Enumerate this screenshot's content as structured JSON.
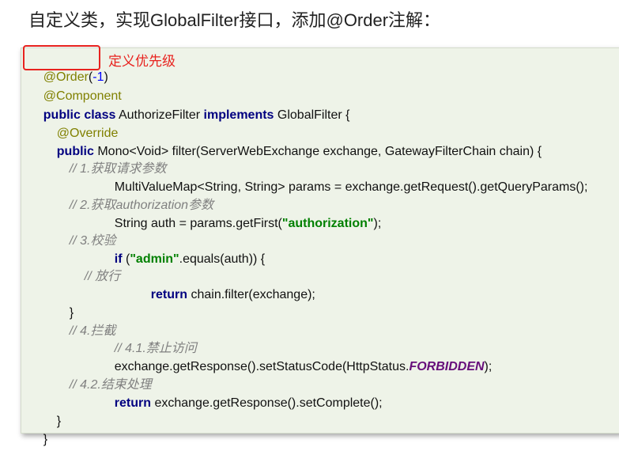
{
  "heading": "自定义类，实现GlobalFilter接口，添加@Order注解：",
  "callout": "定义优先级",
  "code": {
    "l1": {
      "ann": "@Order",
      "p1": "(",
      "num": "-1",
      "p2": ")"
    },
    "l2": {
      "ann": "@Component"
    },
    "l3": {
      "kw1": "public class",
      "t1": " AuthorizeFilter ",
      "kw2": "implements",
      "t2": " GlobalFilter {"
    },
    "l4": {
      "ann": "@Override"
    },
    "l5": {
      "kw": "public",
      "t": " Mono<Void> filter(ServerWebExchange exchange, GatewayFilterChain chain) {"
    },
    "l6": {
      "cmt": "// 1.获取请求参数"
    },
    "l7": {
      "t": "MultiValueMap<String, String> params = exchange.getRequest().getQueryParams();"
    },
    "l8": {
      "cmt": "// 2.获取authorization参数"
    },
    "l9": {
      "t1": "String auth = params.getFirst(",
      "str": "\"authorization\"",
      "t2": ");"
    },
    "l10": {
      "cmt": "// 3.校验"
    },
    "l11": {
      "kw": "if",
      "t1": " (",
      "str": "\"admin\"",
      "t2": ".equals(auth)) {"
    },
    "l12": {
      "cmt": "// 放行"
    },
    "l13": {
      "kw": "return",
      "t": " chain.filter(exchange);"
    },
    "l14": {
      "t": "}"
    },
    "l15": {
      "cmt": "// 4.拦截"
    },
    "l16": {
      "cmt": "// 4.1.禁止访问"
    },
    "l17": {
      "t1": "exchange.getResponse().setStatusCode(HttpStatus.",
      "const": "FORBIDDEN",
      "t2": ");"
    },
    "l18": {
      "cmt": "// 4.2.结束处理"
    },
    "l19": {
      "kw": "return",
      "t": " exchange.getResponse().setComplete();"
    },
    "l20": {
      "t": "}"
    },
    "l21": {
      "t": "}"
    }
  }
}
